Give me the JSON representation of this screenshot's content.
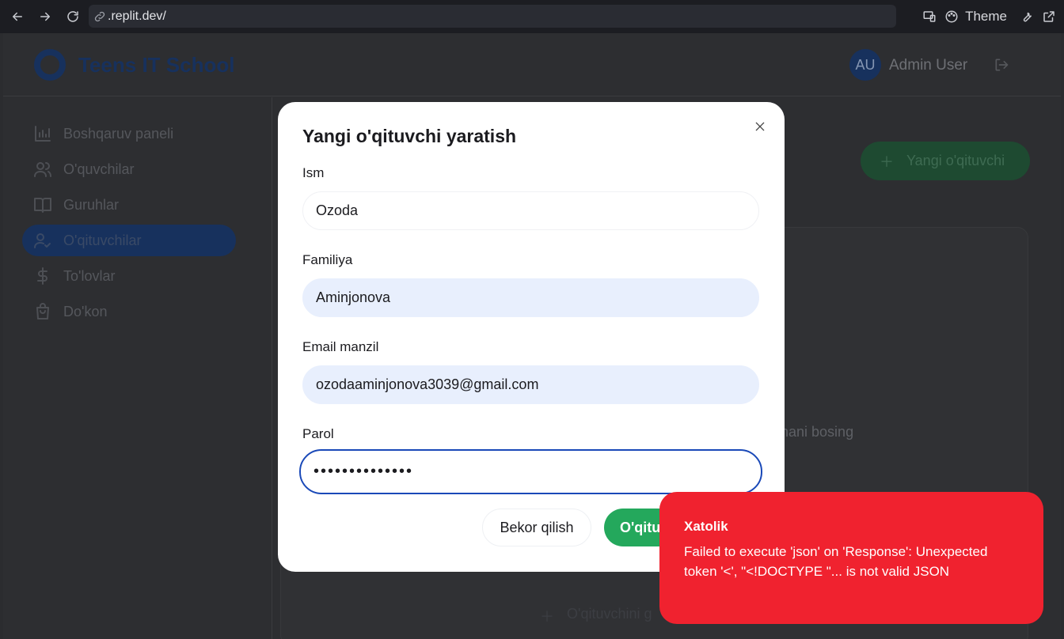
{
  "browser": {
    "url": ".replit.dev/",
    "theme_label": "Theme"
  },
  "header": {
    "brand": "Teens IT School",
    "avatar_initials": "AU",
    "user_name": "Admin User"
  },
  "sidebar": {
    "items": [
      {
        "label": "Boshqaruv paneli",
        "icon": "bar-chart-icon"
      },
      {
        "label": "O'quvchilar",
        "icon": "users-icon"
      },
      {
        "label": "Guruhlar",
        "icon": "book-open-icon"
      },
      {
        "label": "O'qituvchilar",
        "icon": "user-check-icon",
        "active": true
      },
      {
        "label": "To'lovlar",
        "icon": "dollar-icon"
      },
      {
        "label": "Do'kon",
        "icon": "shopping-bag-icon"
      }
    ]
  },
  "main": {
    "new_teacher_button": "Yangi o'qituvchi",
    "hint_fragment": "nani bosing",
    "add_teacher_fragment": "O'qituvchini g"
  },
  "modal": {
    "title": "Yangi o'qituvchi yaratish",
    "fields": {
      "first_name": {
        "label": "Ism",
        "value": "Ozoda"
      },
      "last_name": {
        "label": "Familiya",
        "value": "Aminjonova"
      },
      "email": {
        "label": "Email manzil",
        "value": "ozodaaminjonova3039@gmail.com"
      },
      "password": {
        "label": "Parol",
        "value": "••••••••••••••"
      }
    },
    "cancel_label": "Bekor qilish",
    "submit_label": "O'qituvchi yaratish"
  },
  "toast": {
    "title": "Xatolik",
    "message": "Failed to execute 'json' on 'Response': Unexpected token '<', \"<!DOCTYPE \"... is not valid JSON"
  },
  "colors": {
    "brand_dark_blue": "#17315d",
    "submit_green": "#24a85c",
    "error_red": "#f0222f",
    "focus_blue": "#1a49b8",
    "filled_input": "#e8effd"
  }
}
